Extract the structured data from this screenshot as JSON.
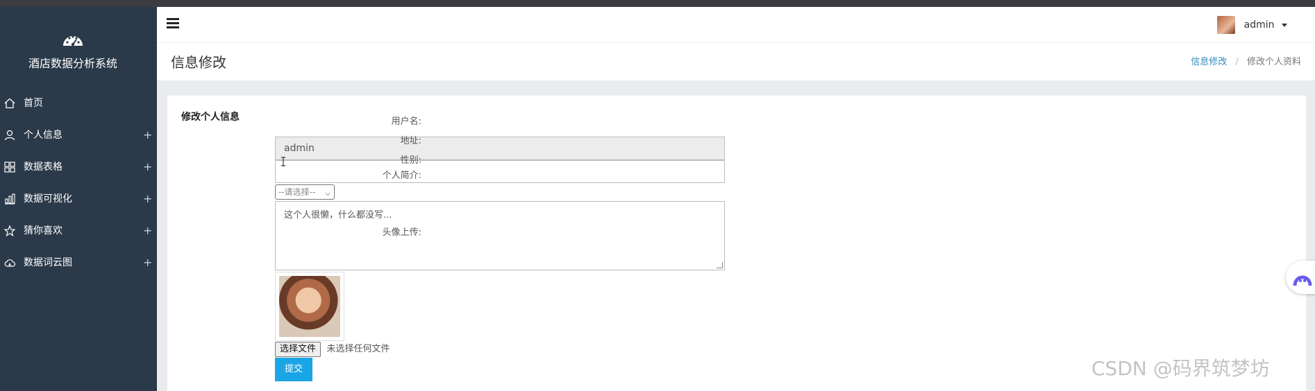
{
  "app": {
    "title": "酒店数据分析系统",
    "logo_icon": "dashboard-gauge-icon"
  },
  "sidebar": {
    "items": [
      {
        "label": "首页",
        "icon": "home-icon",
        "expandable": false
      },
      {
        "label": "个人信息",
        "icon": "user-icon",
        "expandable": true
      },
      {
        "label": "数据表格",
        "icon": "grid-icon",
        "expandable": true
      },
      {
        "label": "数据可视化",
        "icon": "bar-chart-icon",
        "expandable": true
      },
      {
        "label": "猜你喜欢",
        "icon": "star-icon",
        "expandable": true
      },
      {
        "label": "数据词云图",
        "icon": "cloud-icon",
        "expandable": true
      }
    ],
    "expand_symbol": "+"
  },
  "header": {
    "user_name": "admin"
  },
  "page": {
    "title": "信息修改",
    "breadcrumb": {
      "link": "信息修改",
      "separator": "/",
      "current": "修改个人资料"
    }
  },
  "form": {
    "title": "修改个人信息",
    "username": {
      "label": "用户名:",
      "value": "admin"
    },
    "address": {
      "label": "地址:",
      "value": ""
    },
    "gender": {
      "label": "性别:",
      "selected": "--请选择--"
    },
    "intro": {
      "label": "个人简介:",
      "value": "这个人很懒，什么都没写..."
    },
    "avatar": {
      "label": "头像上传:",
      "file_button": "选择文件",
      "file_status": "未选择任何文件"
    },
    "submit_label": "提交"
  },
  "watermark": "CSDN @码界筑梦坊",
  "colors": {
    "sidebar_bg": "#2b3a4a",
    "accent": "#1aa5e6",
    "link": "#2f8ab9"
  }
}
